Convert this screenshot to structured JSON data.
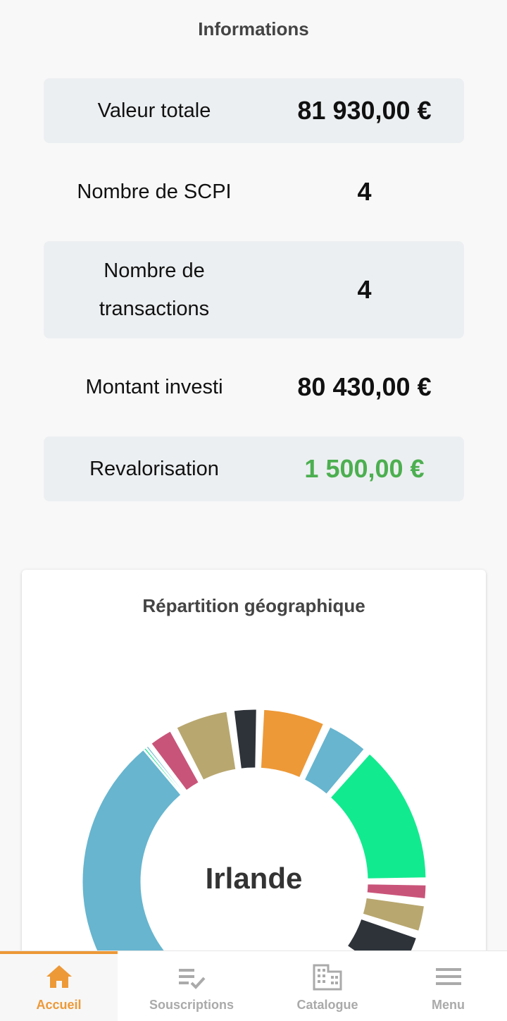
{
  "informations": {
    "title": "Informations",
    "rows": [
      {
        "label": "Valeur totale",
        "value": "81 930,00 €"
      },
      {
        "label": "Nombre de SCPI",
        "value": "4"
      },
      {
        "label": "Nombre de\ntransactions",
        "value": "4"
      },
      {
        "label": "Montant investi",
        "value": "80 430,00 €"
      },
      {
        "label": "Revalorisation",
        "value": "1 500,00 €",
        "color": "#4caf50"
      }
    ]
  },
  "geo": {
    "title": "Répartition géographique",
    "selected": "Irlande",
    "colors": {
      "blue": "#67b5cf",
      "green": "#12ea8f",
      "pink": "#c9547a",
      "khaki": "#b8a76f",
      "dark": "#2e333a",
      "orange": "#ed9937"
    }
  },
  "nav": {
    "accent": "#ed9937",
    "tabs": [
      {
        "label": "Accueil",
        "icon": "home-icon",
        "active": true
      },
      {
        "label": "Souscriptions",
        "icon": "checklist-icon",
        "active": false
      },
      {
        "label": "Catalogue",
        "icon": "building-icon",
        "active": false
      },
      {
        "label": "Menu",
        "icon": "menu-icon",
        "active": false
      }
    ]
  }
}
